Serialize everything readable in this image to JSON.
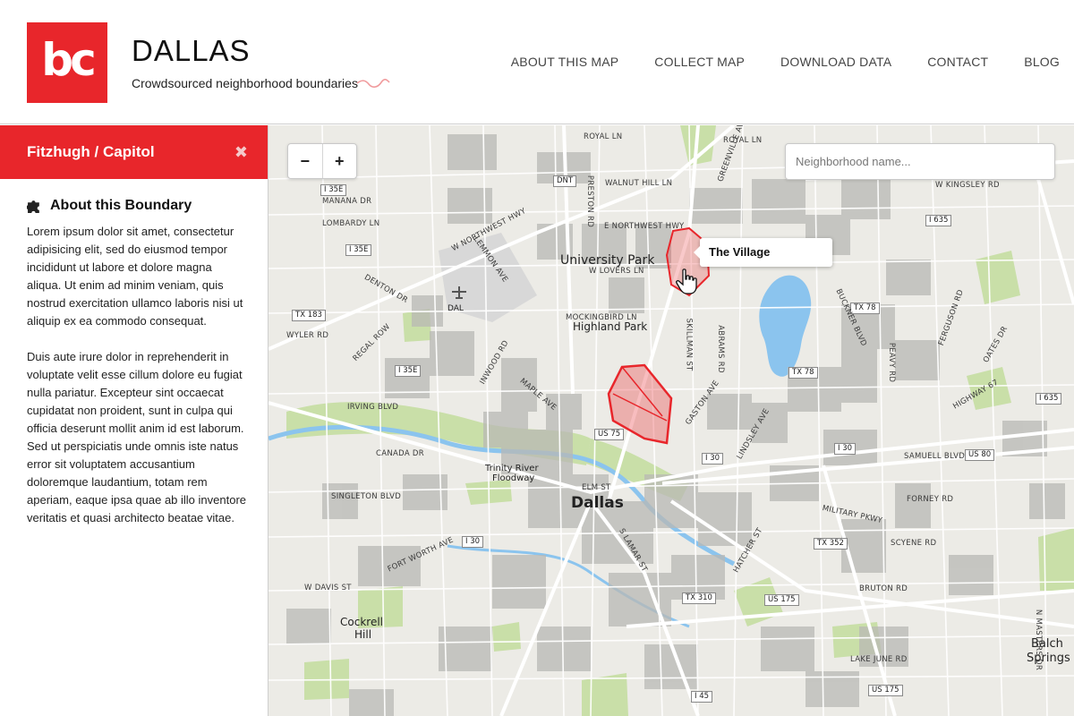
{
  "header": {
    "logo_text": "bc",
    "title": "DALLAS",
    "tagline": "Crowdsourced neighborhood boundaries",
    "nav": [
      "ABOUT THIS MAP",
      "COLLECT MAP",
      "DOWNLOAD DATA",
      "CONTACT",
      "BLOG"
    ]
  },
  "sidebar": {
    "neighborhood": "Fitzhugh / Capitol",
    "close": "✖",
    "about_title": "About this Boundary",
    "paragraphs": [
      "Lorem ipsum dolor sit amet, consectetur adipisicing elit, sed do eiusmod tempor incididunt ut labore et dolore magna aliqua. Ut enim ad minim veniam, quis nostrud exercitation ullamco laboris nisi ut aliquip ex ea commodo consequat.",
      "Duis aute irure dolor in reprehenderit in voluptate velit esse cillum dolore eu fugiat nulla pariatur. Excepteur sint occaecat cupidatat non proident, sunt in culpa qui officia deserunt mollit anim id est laborum. Sed ut perspiciatis unde omnis iste natus error sit voluptatem accusantium doloremque laudantium, totam rem aperiam, eaque ipsa quae ab illo inventore veritatis et quasi architecto beatae vitae."
    ]
  },
  "map": {
    "zoom_out": "−",
    "zoom_in": "+",
    "search_placeholder": "Neighborhood name...",
    "tooltip": "The Village",
    "places": {
      "university_park": "University Park",
      "highland_park": "Highland Park",
      "dallas": "Dallas",
      "dal": "DAL",
      "trinity_river": "Trinity River",
      "floodway": "Floodway",
      "cockrell": "Cockrell",
      "hill": "Hill",
      "balch": "Balch",
      "springs": "Springs"
    },
    "shields": {
      "i35e_a": "I 35E",
      "i35e_b": "I 35E",
      "i35e_c": "I 35E",
      "tx183": "TX 183",
      "tx78_a": "TX 78",
      "tx78_b": "TX 78",
      "i635_a": "I 635",
      "i635_b": "I 635",
      "us75": "US 75",
      "i30_a": "I 30",
      "i30_b": "I 30",
      "i30_c": "I 30",
      "us80": "US 80",
      "tx352": "TX 352",
      "tx310": "TX 310",
      "us175": "US 175",
      "i45": "I 45",
      "us175_b": "US 175",
      "dnt": "DNT"
    },
    "streets": {
      "royal_ln": "ROYAL LN",
      "royal_ln_b": "ROYAL LN",
      "walnut_hill": "WALNUT HILL LN",
      "manana": "MANANA DR",
      "lombardy": "LOMBARDY LN",
      "nw_hwy": "W NORTHWEST HWY",
      "nw_hwy_e": "E NORTHWEST HWY",
      "lovers": "W LOVERS LN",
      "mockingbird": "MOCKINGBIRD LN",
      "denton": "DENTON DR",
      "lemmon": "LEMMON AVE",
      "wyler": "WYLER RD",
      "regal_row": "REGAL ROW",
      "inwood": "INWOOD RD",
      "maple": "MAPLE AVE",
      "irving": "IRVING BLVD",
      "canada": "CANADA DR",
      "singleton": "SINGLETON BLVD",
      "fort_worth": "FORT WORTH AVE",
      "w_davis": "W DAVIS ST",
      "elm": "ELM ST",
      "gaston": "GASTON AVE",
      "samuell": "SAMUELL BLVD",
      "forney": "FORNEY RD",
      "military": "MILITARY PKWY",
      "scyene": "SCYENE RD",
      "bruton": "BRUTON RD",
      "lake_june": "LAKE JUNE RD",
      "kingsley": "W KINGSLEY RD",
      "skillman": "SKILLMAN ST",
      "abrams": "ABRAMS RD",
      "buckner": "BUCKNER BLVD",
      "ferguson": "FERGUSON RD",
      "lamar": "S LAMAR ST",
      "hatcher": "HATCHER ST",
      "greenville": "GREENVILLE AVE",
      "preston": "PRESTON RD",
      "peavy": "PEAVY RD",
      "highway67": "HIGHWAY 67",
      "oates": "OATES DR",
      "lindsley": "LINDSLEY AVE",
      "masters": "N MASTERS DR"
    }
  },
  "colors": {
    "brand_red": "#e8262b",
    "map_base": "#ecebe6",
    "park_green": "#c9dfa8",
    "water_blue": "#8bc4ee",
    "neighborhood_gray": "#b9b9b5",
    "highlight_red": "#e8262b"
  },
  "icons": {
    "close": "close-icon",
    "about": "puzzle-icon",
    "cursor": "hand-pointer-icon",
    "airport": "airplane-icon"
  }
}
